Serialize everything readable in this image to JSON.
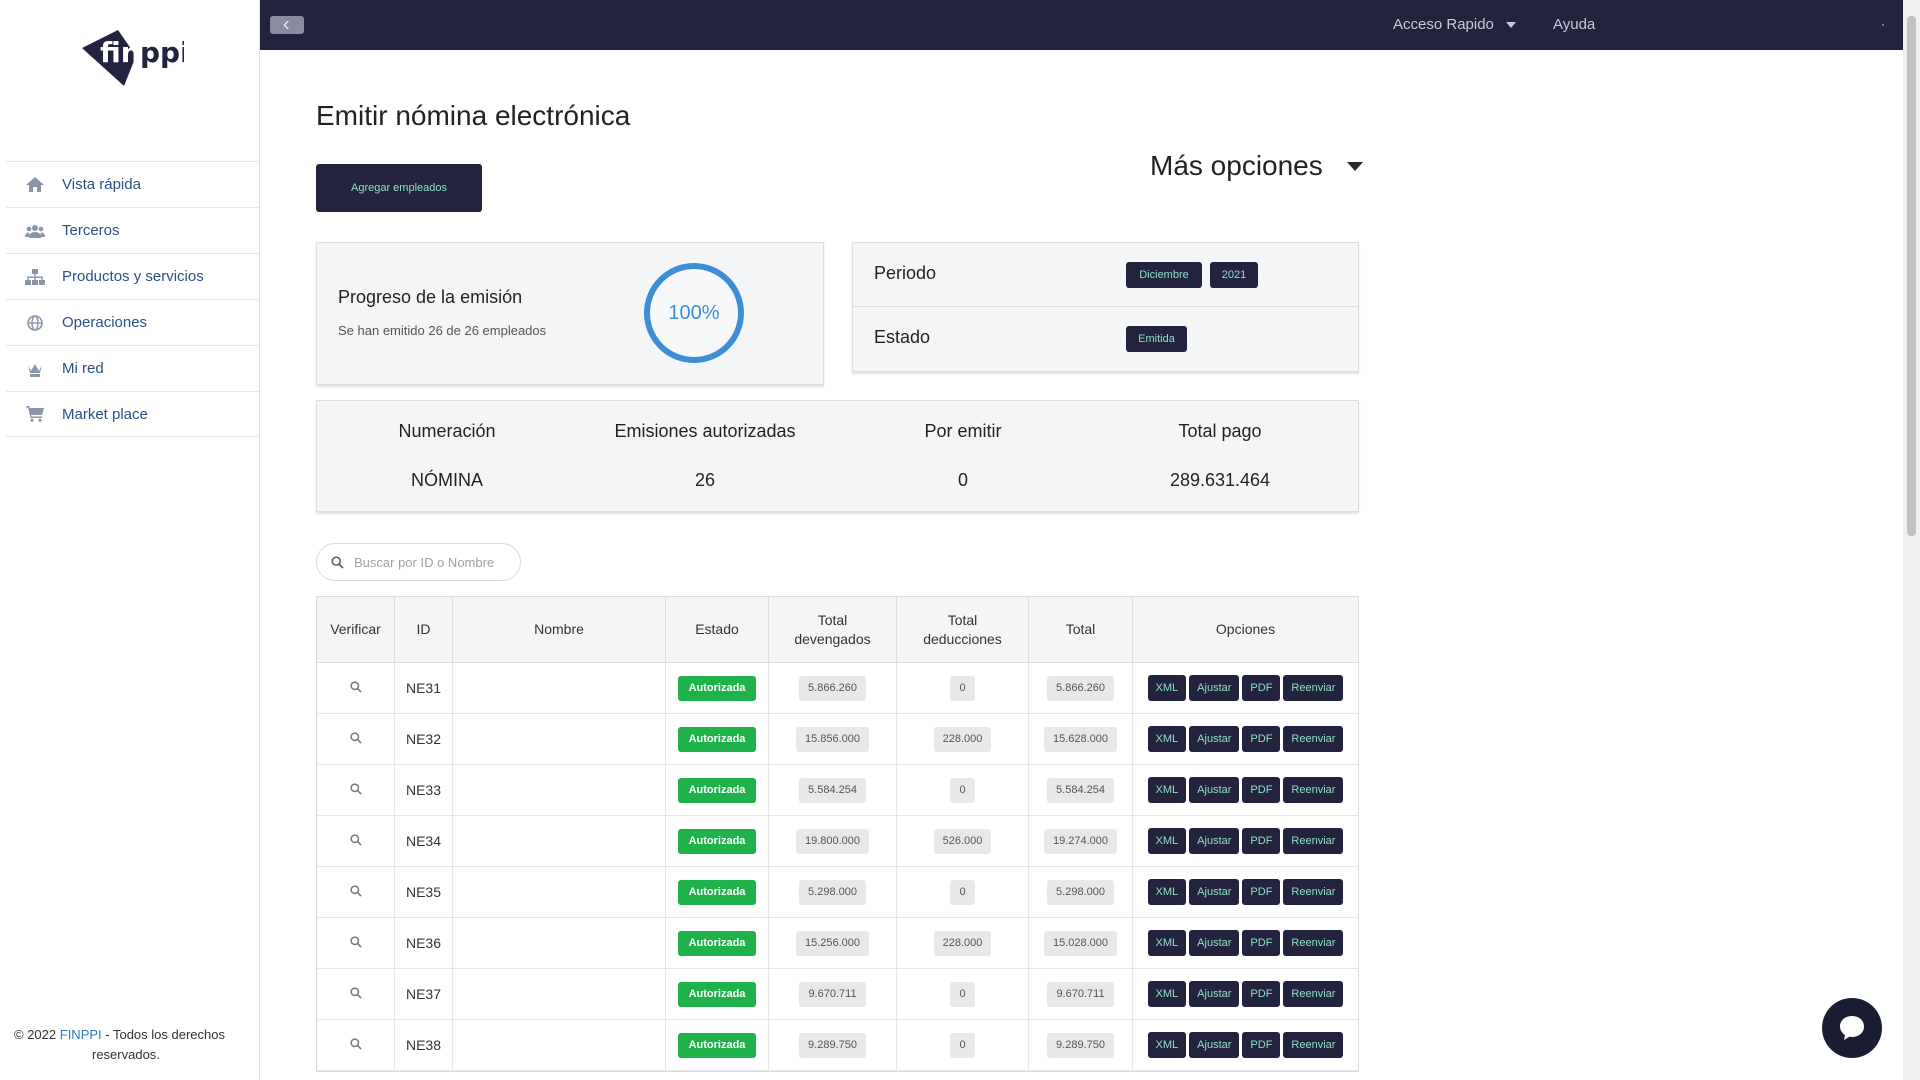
{
  "brand": {
    "logo_text": "finppi"
  },
  "sidebar": {
    "items": [
      {
        "label": "Vista rápida",
        "icon": "home-icon"
      },
      {
        "label": "Terceros",
        "icon": "users-icon"
      },
      {
        "label": "Productos y servicios",
        "icon": "sitemap-icon"
      },
      {
        "label": "Operaciones",
        "icon": "globe-icon"
      },
      {
        "label": "Mi red",
        "icon": "chess-queen-icon"
      },
      {
        "label": "Market place",
        "icon": "cart-icon"
      }
    ],
    "footer": {
      "copyright": "© 2022",
      "brand": "FINPPI",
      "rest": " - Todos los derechos",
      "line2": "reservados."
    }
  },
  "topbar": {
    "quick_access": "Acceso Rapido",
    "help": "Ayuda"
  },
  "page": {
    "title": "Emitir nómina electrónica",
    "add_button": "Agregar empleados",
    "more_options": "Más opciones"
  },
  "progress": {
    "title": "Progreso de la emisión",
    "subtitle": "Se han emitido 26 de 26 empleados",
    "percent_label": "100%",
    "percent": 100
  },
  "period": {
    "period_label": "Periodo",
    "month": "Diciembre",
    "year": "2021",
    "status_label": "Estado",
    "status": "Emitida"
  },
  "stats": [
    {
      "label": "Numeración",
      "value": "NÓMINA"
    },
    {
      "label": "Emisiones autorizadas",
      "value": "26"
    },
    {
      "label": "Por emitir",
      "value": "0"
    },
    {
      "label": "Total pago",
      "value": "289.631.464"
    }
  ],
  "search": {
    "placeholder": "Buscar por ID o Nombre"
  },
  "table": {
    "headers": {
      "verify": "Verificar",
      "id": "ID",
      "name": "Nombre",
      "status": "Estado",
      "devengados_1": "Total",
      "devengados_2": "devengados",
      "deducciones_1": "Total",
      "deducciones_2": "deducciones",
      "total": "Total",
      "options": "Opciones"
    },
    "option_labels": {
      "xml": "XML",
      "adjust": "Ajustar",
      "pdf": "PDF",
      "resend": "Reenviar"
    },
    "rows": [
      {
        "id": "NE31",
        "status": "Autorizada",
        "devengados": "5.866.260",
        "deducciones": "0",
        "total": "5.866.260"
      },
      {
        "id": "NE32",
        "status": "Autorizada",
        "devengados": "15.856.000",
        "deducciones": "228.000",
        "total": "15.628.000"
      },
      {
        "id": "NE33",
        "status": "Autorizada",
        "devengados": "5.584.254",
        "deducciones": "0",
        "total": "5.584.254"
      },
      {
        "id": "NE34",
        "status": "Autorizada",
        "devengados": "19.800.000",
        "deducciones": "526.000",
        "total": "19.274.000"
      },
      {
        "id": "NE35",
        "status": "Autorizada",
        "devengados": "5.298.000",
        "deducciones": "0",
        "total": "5.298.000"
      },
      {
        "id": "NE36",
        "status": "Autorizada",
        "devengados": "15.256.000",
        "deducciones": "228.000",
        "total": "15.028.000"
      },
      {
        "id": "NE37",
        "status": "Autorizada",
        "devengados": "9.670.711",
        "deducciones": "0",
        "total": "9.670.711"
      },
      {
        "id": "NE38",
        "status": "Autorizada",
        "devengados": "9.289.750",
        "deducciones": "0",
        "total": "9.289.750"
      }
    ]
  },
  "colors": {
    "navy": "#23223f",
    "accent_green_text": "#8ee0c3",
    "status_green": "#1fb24a",
    "link_blue": "#2d4f86",
    "progress_blue": "#3d8ed6"
  }
}
